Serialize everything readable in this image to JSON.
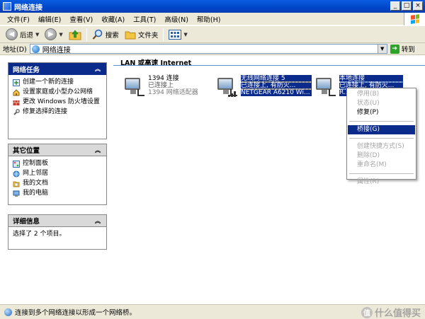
{
  "window": {
    "title": "网络连接",
    "controls": [
      "_",
      "□",
      "×"
    ]
  },
  "menubar": {
    "items": [
      "文件(F)",
      "编辑(E)",
      "查看(V)",
      "收藏(A)",
      "工具(T)",
      "高级(N)",
      "帮助(H)"
    ]
  },
  "toolbar": {
    "back_label": "后退",
    "search_label": "搜索",
    "folders_label": "文件夹"
  },
  "address": {
    "label": "地址(D)",
    "value": "网络连接",
    "go_label": "转到"
  },
  "sidebar": {
    "tasks": {
      "title": "网络任务",
      "items": [
        {
          "label": "创建一个新的连接",
          "icon": "new-connection-icon"
        },
        {
          "label": "设置家庭或小型办公网络",
          "icon": "home-network-icon"
        },
        {
          "label": "更改 Windows 防火墙设置",
          "icon": "firewall-icon"
        },
        {
          "label": "修复选择的连接",
          "icon": "repair-icon"
        }
      ]
    },
    "other": {
      "title": "其它位置",
      "items": [
        {
          "label": "控制面板",
          "icon": "control-panel-icon"
        },
        {
          "label": "网上邻居",
          "icon": "network-places-icon"
        },
        {
          "label": "我的文档",
          "icon": "documents-icon"
        },
        {
          "label": "我的电脑",
          "icon": "computer-icon"
        }
      ]
    },
    "details": {
      "title": "详细信息",
      "text": "选择了 2 个项目。"
    }
  },
  "content": {
    "group_header": "LAN 或高速 Internet",
    "connections": [
      {
        "name": "1394 连接",
        "status": "已连接上",
        "device": "1394 网络适配器",
        "selected": false
      },
      {
        "name": "无线网络连接 5",
        "status": "已连接上, 有防火...",
        "device": "NETGEAR A6210 Wi...",
        "selected": true
      },
      {
        "name": "本地连接",
        "status": "已连接上, 有防火...",
        "device": "R...",
        "selected": true
      }
    ]
  },
  "context_menu": {
    "items": [
      {
        "label": "停用(B)",
        "state": "disabled"
      },
      {
        "label": "状态(U)",
        "state": "disabled"
      },
      {
        "label": "修复(P)",
        "state": "normal"
      },
      {
        "label": "桥接(G)",
        "state": "active"
      },
      {
        "label": "创建快捷方式(S)",
        "state": "disabled"
      },
      {
        "label": "删除(D)",
        "state": "disabled"
      },
      {
        "label": "重命名(M)",
        "state": "disabled"
      },
      {
        "label": "属性(R)",
        "state": "disabled"
      }
    ]
  },
  "statusbar": {
    "text": "连接到多个网络连接以形成一个网络桥。",
    "watermark": "什么值得买"
  },
  "colors": {
    "titlebar": "#0046c8",
    "selection": "#0a2a8c",
    "panel_header": "#0a2a8c",
    "chrome": "#ece9d8"
  }
}
